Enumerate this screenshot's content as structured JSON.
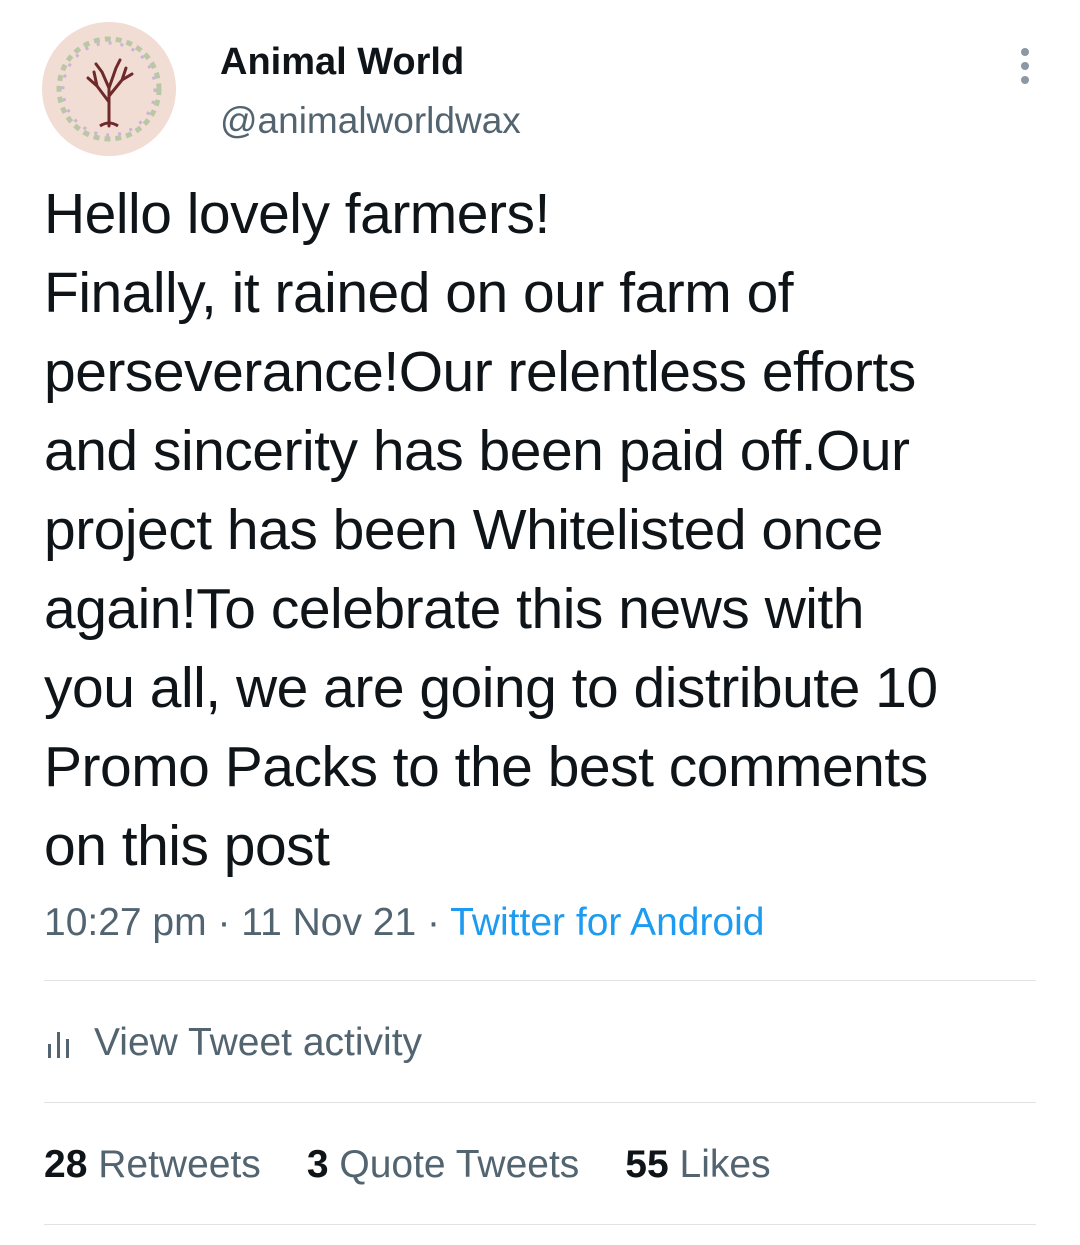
{
  "author": {
    "display_name": "Animal World",
    "handle": "@animalworldwax",
    "avatar_icon": "tree-wreath-avatar"
  },
  "tweet": {
    "text": "Hello lovely farmers!\nFinally, it rained on our farm of\nperseverance!Our relentless efforts\nand sincerity has been paid off.Our\nproject has been Whitelisted once\nagain!To celebrate this news with\nyou all, we are going to distribute 10\nPromo Packs to the best comments\non this post",
    "time": "10:27 pm",
    "separator": "·",
    "date": "11 Nov 21",
    "source": "Twitter for Android"
  },
  "activity": {
    "icon": "bar-chart-icon",
    "label": "View Tweet activity"
  },
  "stats": [
    {
      "count": "28",
      "label": "Retweets"
    },
    {
      "count": "3",
      "label": "Quote Tweets"
    },
    {
      "count": "55",
      "label": "Likes"
    }
  ],
  "colors": {
    "text": "#0f1419",
    "secondary": "#536471",
    "link": "#1d9bf0",
    "divider": "#dfe3e6"
  }
}
